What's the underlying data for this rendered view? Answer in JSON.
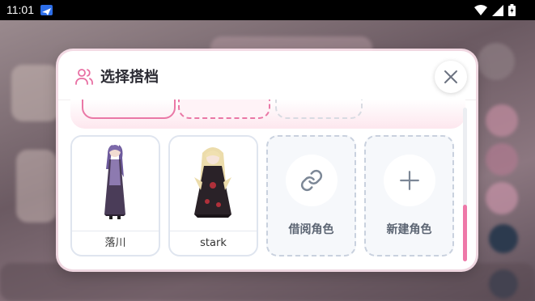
{
  "status_bar": {
    "time": "11:01",
    "app_icon": "paper-plane-icon",
    "icons": [
      "wifi-icon",
      "signal-icon",
      "battery-icon"
    ]
  },
  "dialog": {
    "title": "选择搭档",
    "title_icon": "users-icon",
    "close_icon": "close-icon",
    "characters": [
      {
        "name": "落川"
      },
      {
        "name": "stark"
      }
    ],
    "actions": [
      {
        "label": "借阅角色",
        "icon": "link-icon"
      },
      {
        "label": "新建角色",
        "icon": "plus-icon"
      }
    ]
  },
  "colors": {
    "accent": "#ea78a6",
    "scroll_thumb": "#ee78a8",
    "title_icon": "#e86fa3"
  }
}
